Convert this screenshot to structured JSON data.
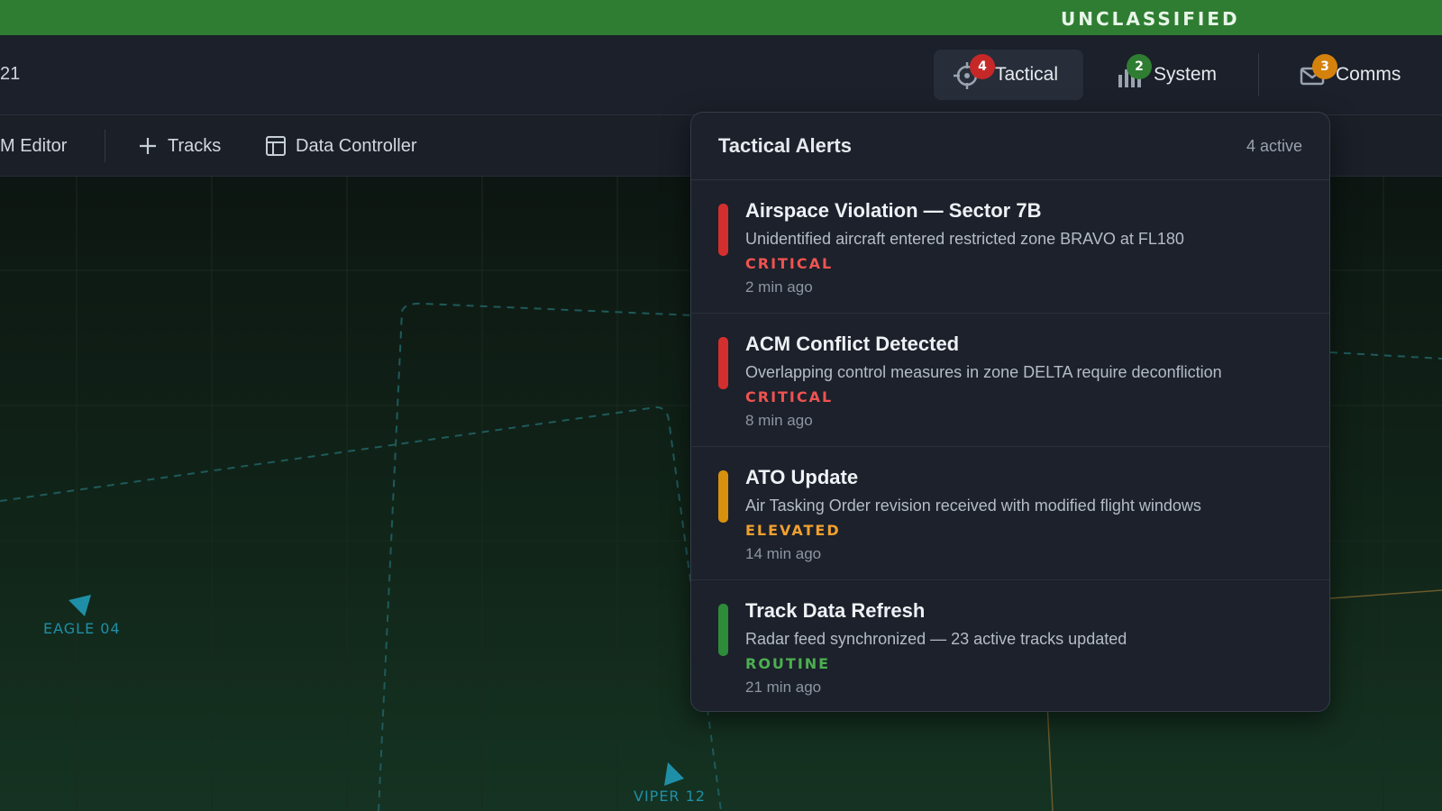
{
  "classification": {
    "label": "UNCLASSIFIED",
    "color": "#2f7d32"
  },
  "header": {
    "left_text": "21",
    "nav": [
      {
        "label": "Tactical",
        "icon": "crosshair-icon",
        "badge": "4",
        "badge_color": "#c62828",
        "active": true
      },
      {
        "label": "System",
        "icon": "bar-chart-icon",
        "badge": "2",
        "badge_color": "#2e7d32",
        "active": false
      },
      {
        "label": "Comms",
        "icon": "mail-icon",
        "badge": "3",
        "badge_color": "#d4820c",
        "active": false
      }
    ]
  },
  "toolbar": {
    "items": [
      {
        "label": "M Editor",
        "icon": ""
      },
      {
        "label": "Tracks",
        "icon": "plus-icon"
      },
      {
        "label": "Data Controller",
        "icon": "table-icon"
      }
    ]
  },
  "map": {
    "tracks": [
      {
        "label": "EAGLE 04",
        "icon": "aircraft-icon"
      },
      {
        "label": "VIPER 12",
        "icon": "aircraft-icon"
      }
    ]
  },
  "alerts_panel": {
    "title": "Tactical Alerts",
    "count": "4 active",
    "alerts": [
      {
        "title": "Airspace Violation — Sector 7B",
        "description": "Unidentified aircraft entered restricted zone BRAVO at FL180",
        "level": "CRITICAL",
        "time": "2 min ago",
        "color": "#d32f2f"
      },
      {
        "title": "ACM Conflict Detected",
        "description": "Overlapping control measures in zone DELTA require deconfliction",
        "level": "CRITICAL",
        "time": "8 min ago",
        "color": "#d32f2f"
      },
      {
        "title": "ATO Update",
        "description": "Air Tasking Order revision received with modified flight windows",
        "level": "ELEVATED",
        "time": "14 min ago",
        "color": "#d8900f"
      },
      {
        "title": "Track Data Refresh",
        "description": "Radar feed synchronized — 23 active tracks updated",
        "level": "ROUTINE",
        "time": "21 min ago",
        "color": "#2e8b3a"
      }
    ]
  },
  "colors": {
    "critical_text": "#ef5350",
    "elevated_text": "#f0a030",
    "routine_text": "#4caf50",
    "track": "#1f8fa8"
  }
}
